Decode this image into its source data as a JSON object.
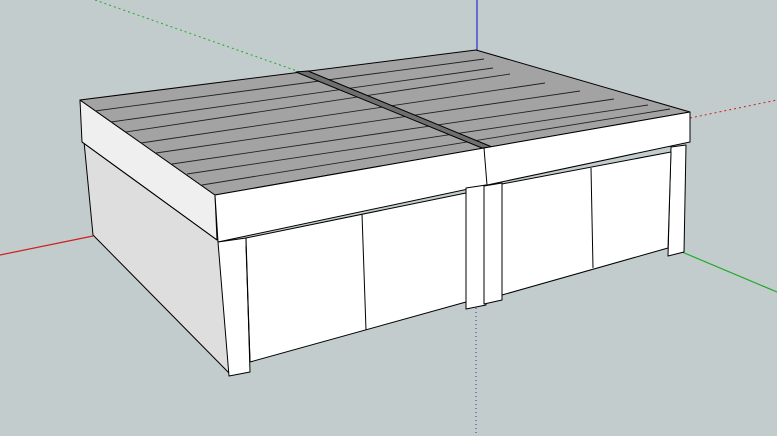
{
  "viewport": {
    "background": "#c3cccd",
    "axis_colors": {
      "red": "#cc2020",
      "green": "#1faa2a",
      "blue": "#2a2ad0"
    }
  },
  "model": {
    "roof_color": "#a3a3a3",
    "wall_color": "#ffffff",
    "side_wall_color": "#dedede",
    "edge_color": "#000000"
  }
}
